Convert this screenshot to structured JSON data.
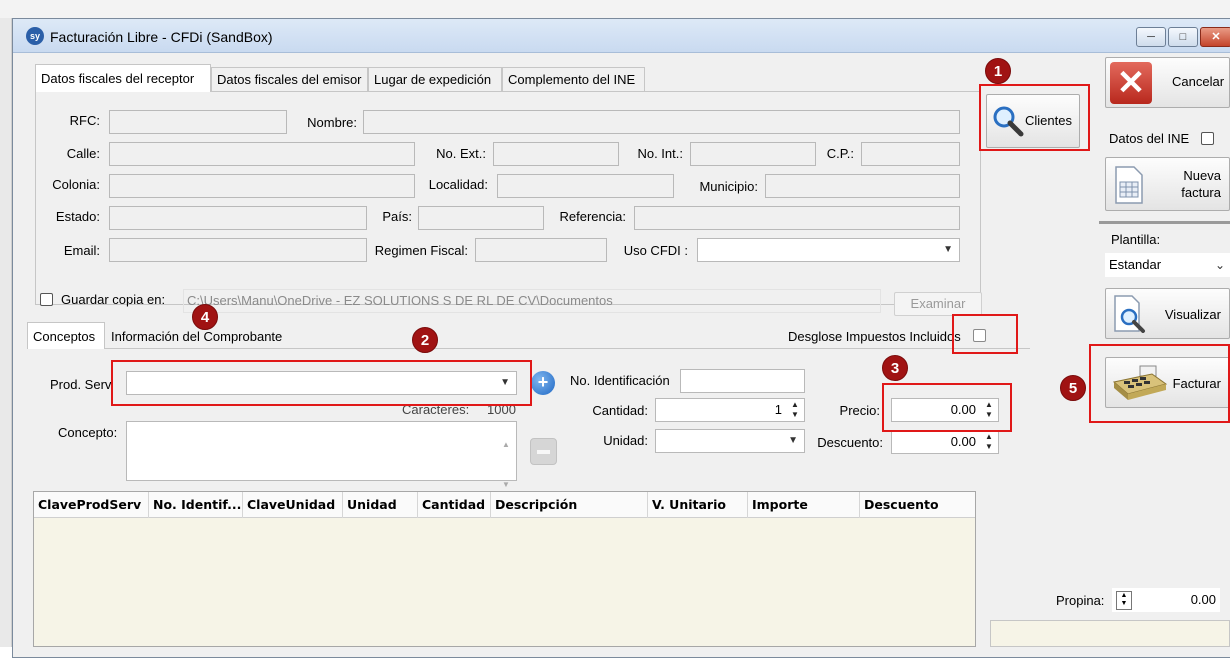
{
  "window": {
    "title": "Facturación Libre - CFDi (SandBox)",
    "icon_text": "sy"
  },
  "receptor_tabs": [
    {
      "label": "Datos fiscales del receptor"
    },
    {
      "label": "Datos fiscales del emisor"
    },
    {
      "label": "Lugar de expedición"
    },
    {
      "label": "Complemento del INE"
    }
  ],
  "receptor": {
    "rfc_label": "RFC:",
    "nombre_label": "Nombre:",
    "calle_label": "Calle:",
    "no_ext_label": "No. Ext.:",
    "no_int_label": "No. Int.:",
    "cp_label": "C.P.:",
    "colonia_label": "Colonia:",
    "localidad_label": "Localidad:",
    "municipio_label": "Municipio:",
    "estado_label": "Estado:",
    "pais_label": "País:",
    "referencia_label": "Referencia:",
    "email_label": "Email:",
    "regimen_label": "Regimen Fiscal:",
    "uso_cfdi_label": "Uso CFDI :"
  },
  "guardar": {
    "label": "Guardar copia en:",
    "path": "C:\\Users\\Manu\\OneDrive - EZ SOLUTIONS S DE RL DE CV\\Documentos",
    "examinar_label": "Examinar"
  },
  "concept_tabs": [
    {
      "label": "Conceptos"
    },
    {
      "label": "Información del Comprobante"
    }
  ],
  "desglose_label": "Desglose Impuestos Incluidos",
  "conceptos": {
    "prod_serv_label": "Prod. Serv.",
    "caracteres_label": "Caracteres:",
    "caracteres_value": "1000",
    "concepto_label": "Concepto:",
    "no_identificacion_label": "No. Identificación",
    "cantidad_label": "Cantidad:",
    "cantidad_value": "1",
    "unidad_label": "Unidad:",
    "precio_label": "Precio:",
    "precio_value": "0.00",
    "descuento_label": "Descuento:",
    "descuento_value": "0.00"
  },
  "table": {
    "columns": [
      "ClaveProdServ",
      "No. Identif...",
      "ClaveUnidad",
      "Unidad",
      "Cantidad",
      "Descripción",
      "V. Unitario",
      "Importe",
      "Descuento"
    ]
  },
  "side": {
    "cancelar_label": "Cancelar",
    "clientes_label": "Clientes",
    "datos_ine_label": "Datos del INE",
    "nueva_factura_line1": "Nueva",
    "nueva_factura_line2": "factura",
    "plantilla_label": "Plantilla:",
    "plantilla_value": "Estandar",
    "visualizar_label": "Visualizar",
    "facturar_label": "Facturar"
  },
  "propina": {
    "label": "Propina:",
    "value": "0.00"
  },
  "annotations": [
    "1",
    "2",
    "3",
    "4",
    "5"
  ],
  "colors": {
    "annotation_red": "#e01818",
    "badge_red": "#a01313",
    "grid_bg": "#f6f4e7"
  }
}
